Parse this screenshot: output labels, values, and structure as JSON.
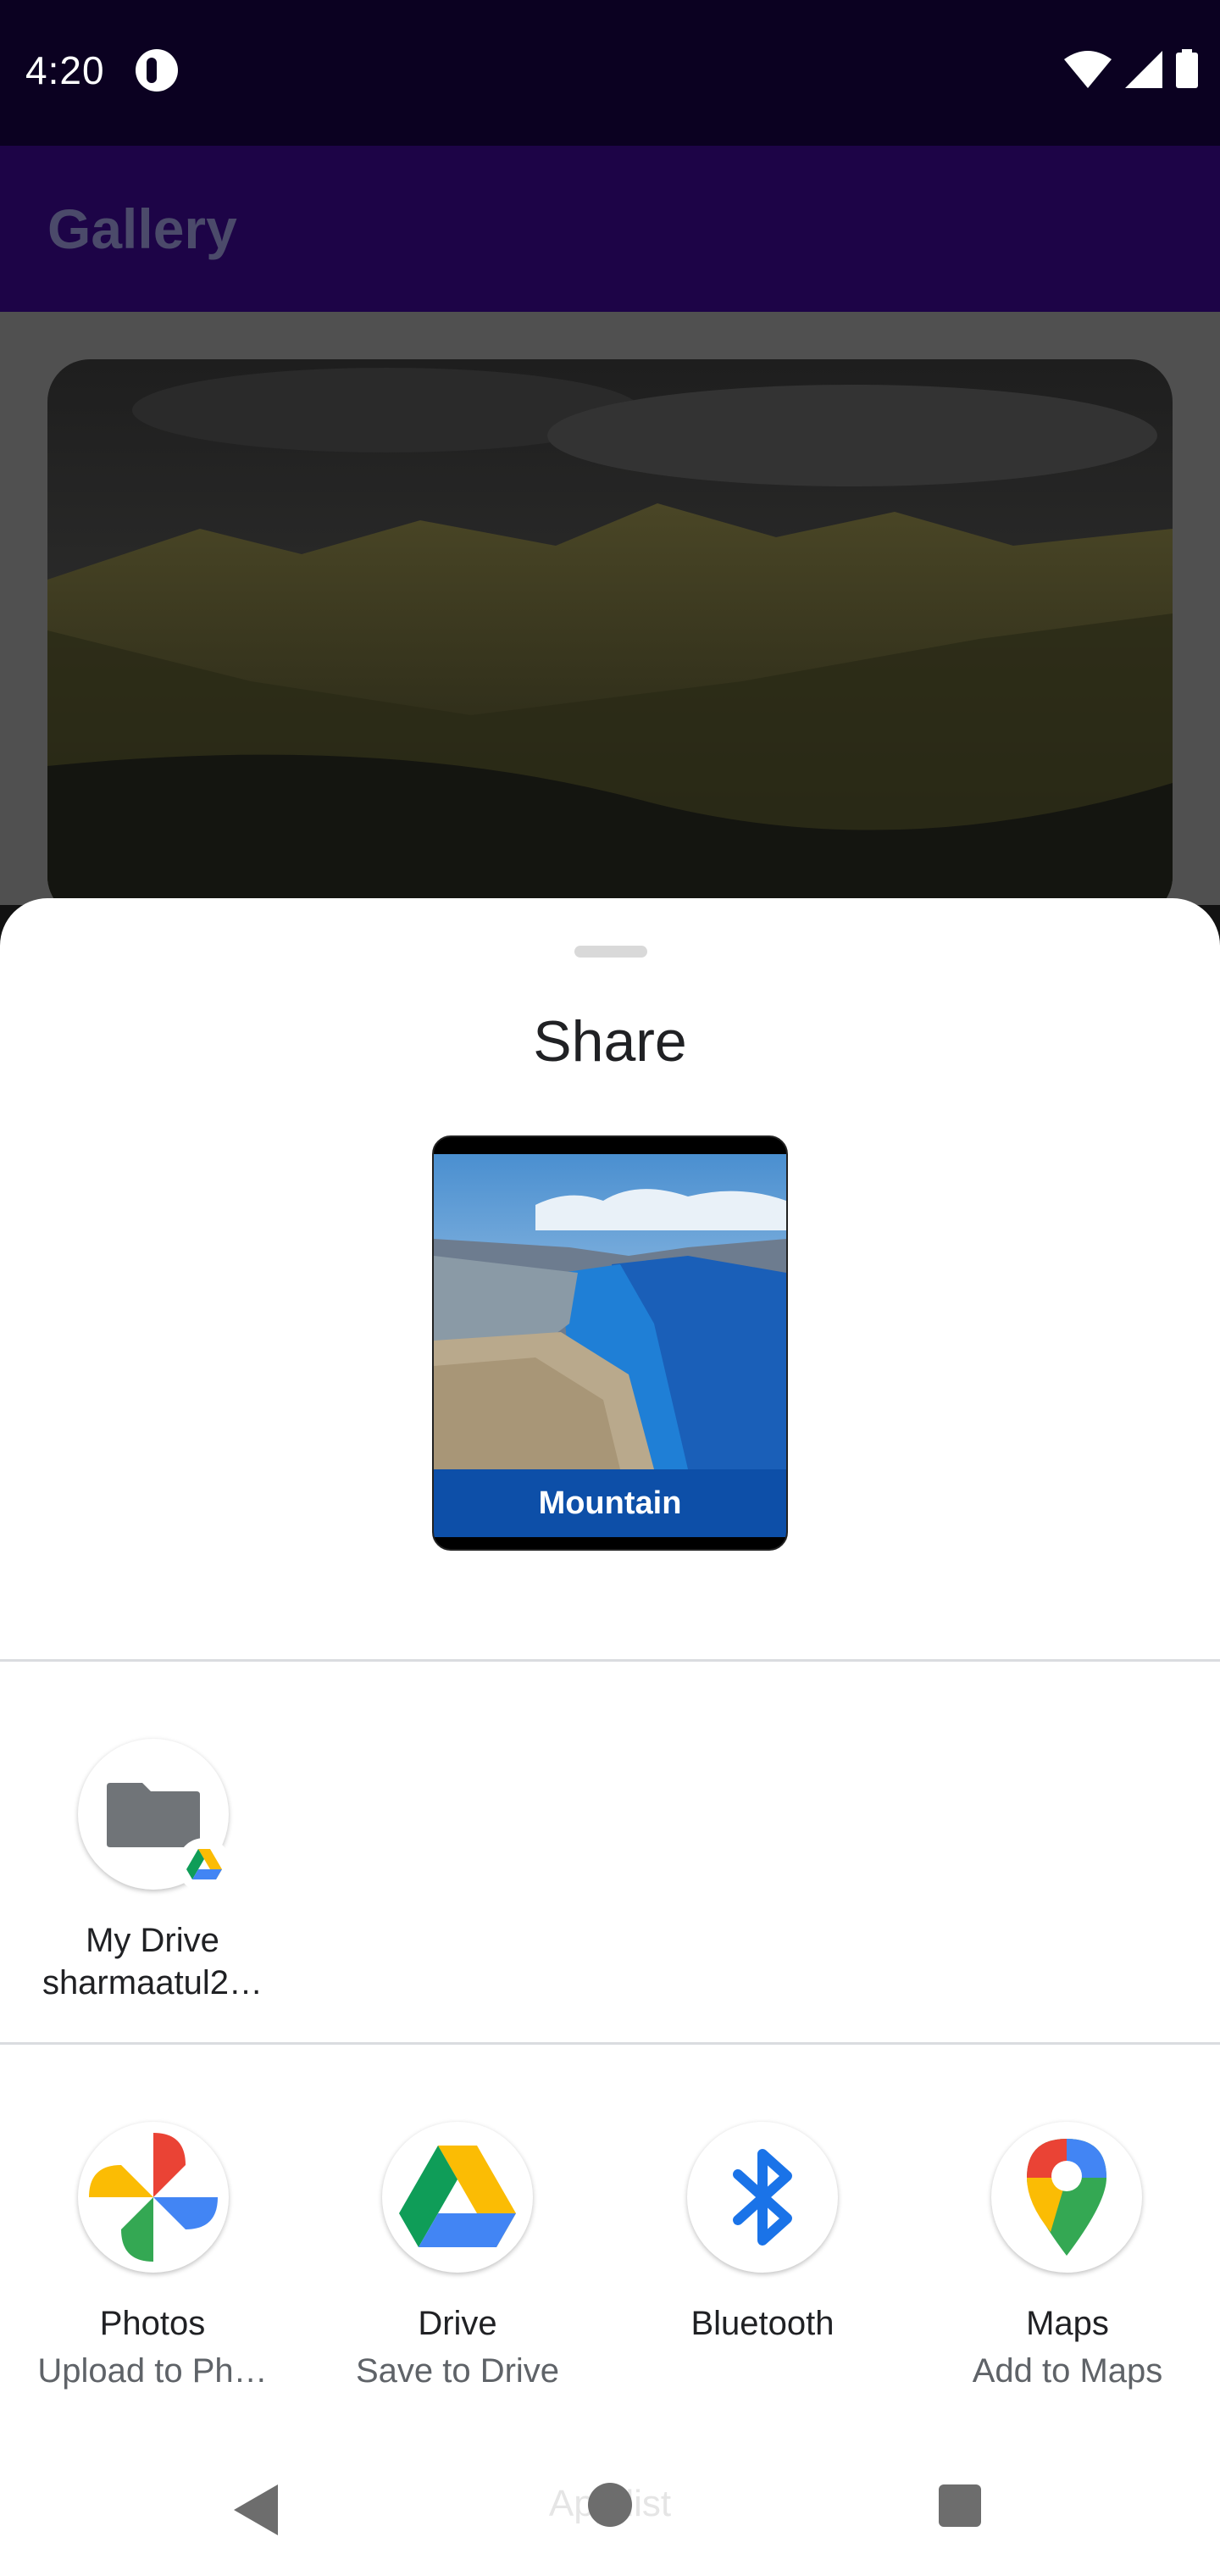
{
  "status": {
    "time": "4:20"
  },
  "app": {
    "title": "Gallery"
  },
  "share": {
    "title": "Share",
    "preview_caption": "Mountain",
    "direct_targets": [
      {
        "name": "My Drive",
        "subtitle": "sharmaatul2…",
        "icon": "folder-drive-icon"
      }
    ],
    "apps": [
      {
        "name": "Photos",
        "subtitle": "Upload to Ph…",
        "icon": "google-photos-icon"
      },
      {
        "name": "Drive",
        "subtitle": "Save to Drive",
        "icon": "google-drive-icon"
      },
      {
        "name": "Bluetooth",
        "subtitle": "",
        "icon": "bluetooth-icon"
      },
      {
        "name": "Maps",
        "subtitle": "Add to Maps",
        "icon": "google-maps-icon"
      }
    ]
  },
  "nav": {
    "ghost_text": "App list"
  },
  "colors": {
    "status_bar": "#0b0121",
    "app_bar": "#1d0447",
    "caption": "#0d4fa8"
  }
}
